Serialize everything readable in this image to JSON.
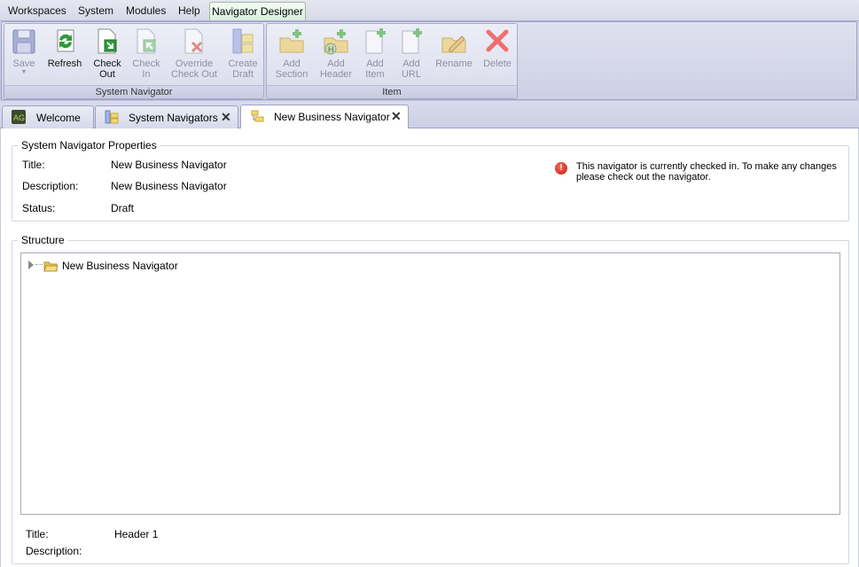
{
  "menu": {
    "items": [
      "Workspaces",
      "System",
      "Modules",
      "Help"
    ],
    "active": "Navigator Designer"
  },
  "ribbon": {
    "system_group": {
      "title": "System Navigator",
      "buttons": [
        {
          "label": "Save",
          "icon": "floppy-disk-icon",
          "enabled": false
        },
        {
          "label": "Refresh",
          "icon": "refresh-icon",
          "enabled": true
        },
        {
          "label": "Check Out",
          "icon": "check-out-icon",
          "enabled": true
        },
        {
          "label": "Check In",
          "icon": "check-in-icon",
          "enabled": false
        },
        {
          "label": "Override Check Out",
          "icon": "override-check-out-icon",
          "enabled": false
        },
        {
          "label": "Create Draft",
          "icon": "create-draft-icon",
          "enabled": false
        }
      ]
    },
    "item_group": {
      "title": "Item",
      "buttons": [
        {
          "label": "Add Section",
          "icon": "add-section-icon",
          "enabled": false
        },
        {
          "label": "Add Header",
          "icon": "add-header-icon",
          "enabled": false
        },
        {
          "label": "Add Item",
          "icon": "add-item-icon",
          "enabled": false
        },
        {
          "label": "Add URL",
          "icon": "add-url-icon",
          "enabled": false
        },
        {
          "label": "Rename",
          "icon": "rename-icon",
          "enabled": false
        },
        {
          "label": "Delete",
          "icon": "delete-icon",
          "enabled": false
        }
      ]
    }
  },
  "tabs": [
    {
      "label": "Welcome",
      "icon": "welcome-icon",
      "closable": false
    },
    {
      "label": "System Navigators",
      "icon": "system-navigators-icon",
      "closable": true
    },
    {
      "label": "New Business Navigator",
      "icon": "navigator-icon",
      "closable": true,
      "active": true
    }
  ],
  "properties": {
    "legend": "System Navigator Properties",
    "title_label": "Title:",
    "title_value": "New Business Navigator",
    "description_label": "Description:",
    "description_value": "New Business Navigator",
    "status_label": "Status:",
    "status_value": "Draft",
    "message": "This navigator is currently checked in. To make any changes please check out the navigator.",
    "message_icon": "error-icon"
  },
  "structure": {
    "legend": "Structure",
    "root_node": "New Business Navigator",
    "title_label": "Title:",
    "title_value": "Header 1",
    "description_label": "Description:",
    "description_value": ""
  },
  "colors": {
    "disabled_text": "#8d8fa6",
    "error_red": "#c61b10",
    "active_menu_bg": "#d8eedc"
  }
}
